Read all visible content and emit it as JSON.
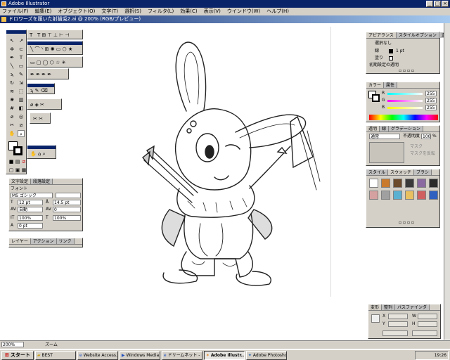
{
  "app": {
    "title": "Adobe Illustrator",
    "document_title": "ドロワーズを履いた射猫兎2.ai @ 200% (RGB/プレビュー)",
    "minimize": "_",
    "maximize": "□",
    "close": "×"
  },
  "menu": [
    "ファイル(F)",
    "編集(E)",
    "オブジェクト(O)",
    "文字(T)",
    "選択(S)",
    "フィルタ(L)",
    "効果(C)",
    "表示(V)",
    "ウインドウ(W)",
    "ヘルプ(H)"
  ],
  "tools": {
    "text_tools": "T"
  },
  "appearance_panel": {
    "tabs": [
      "アピアランス",
      "スタイルオプション",
      "透明"
    ],
    "selection": "選択なし",
    "stroke_label": "線",
    "stroke_value": "1 pt",
    "fill_label": "塗り",
    "default_transparency": "初期設定の透明"
  },
  "color_panel": {
    "tabs": [
      "カラー",
      "属性"
    ],
    "channels": [
      {
        "label": "R",
        "value": "255",
        "color": "#e02020"
      },
      {
        "label": "G",
        "value": "255",
        "color": "#20a020"
      },
      {
        "label": "B",
        "value": "255",
        "color": "#2020e0"
      }
    ]
  },
  "transparency_panel": {
    "tabs": [
      "透明",
      "線",
      "グラデーション"
    ],
    "mode": "通常",
    "opacity_label": "不透明度",
    "opacity_value": "100",
    "opacity_unit": "%",
    "option1": "マスク",
    "option2": "マスクを反転"
  },
  "swatches_panel": {
    "tabs": [
      "スタイル",
      "スウォッチ",
      "ブラシ"
    ],
    "swatch_colors": [
      "#ffffff",
      "#c97a2c",
      "#6a4a2a",
      "#3a3a3a",
      "#8a6aa0",
      "#2a2a2a",
      "#d4a0a0",
      "#a0a0a0",
      "#5ab0d0",
      "#e8c060",
      "#d06060",
      "#3060c0"
    ]
  },
  "character_panel": {
    "tabs": [
      "文字設定",
      "段落設定"
    ],
    "font_label": "フォント",
    "font": "MS ゴシック",
    "size": "12 pt",
    "leading": "14.5 pt",
    "tracking": "自動",
    "kerning": "0",
    "hscale": "100%",
    "vscale": "100%",
    "baseline": "0 pt"
  },
  "layers_panel": {
    "tabs": [
      "レイヤー",
      "アクション",
      "リンク"
    ]
  },
  "transform_panel": {
    "tabs": [
      "変形",
      "整列",
      "パスファインダ"
    ],
    "x_label": "X",
    "y_label": "Y",
    "w_label": "W",
    "h_label": "H"
  },
  "status": {
    "zoom": "200%",
    "tool": "ズーム"
  },
  "taskbar": {
    "start": "スタート",
    "buttons": [
      {
        "label": "BEST",
        "icon": "folder-icon",
        "active": false
      },
      {
        "label": "Website Access...",
        "icon": "browser-icon",
        "active": false
      },
      {
        "label": "Windows Media...",
        "icon": "media-icon",
        "active": false
      },
      {
        "label": "ドリームネット - B...",
        "icon": "browser-icon",
        "active": false
      },
      {
        "label": "Adobe Illustr...",
        "icon": "illustrator-icon",
        "active": true
      },
      {
        "label": "Adobe Photoshop",
        "icon": "photoshop-icon",
        "active": false
      }
    ],
    "clock": "19:26"
  }
}
